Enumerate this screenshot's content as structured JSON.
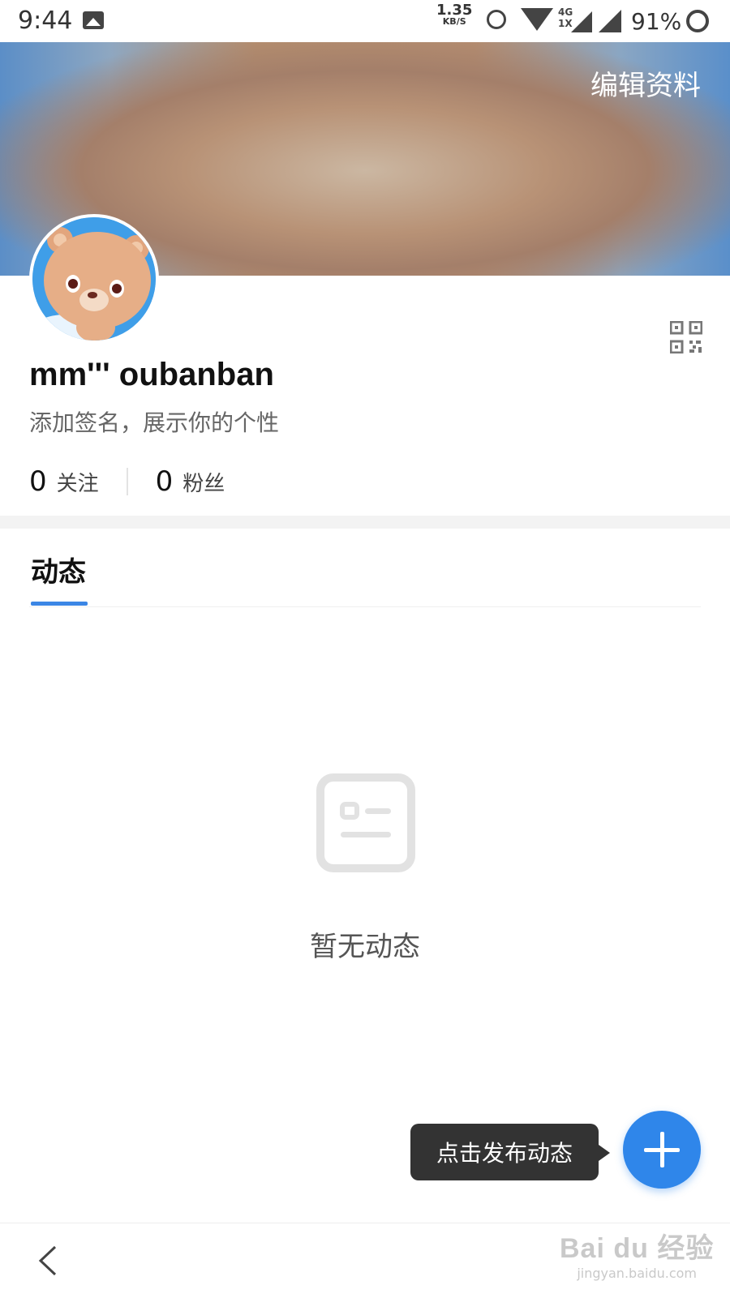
{
  "status_bar": {
    "time": "9:44",
    "speed_value": "1.35",
    "speed_unit": "KB/S",
    "network_top": "4G",
    "network_bottom": "1X",
    "battery": "91%"
  },
  "header": {
    "edit_label": "编辑资料"
  },
  "profile": {
    "username": "mm''' oubanban",
    "signature": "添加签名，展示你的个性",
    "following_count": "0",
    "following_label": "关注",
    "followers_count": "0",
    "followers_label": "粉丝"
  },
  "tabs": [
    {
      "label": "动态",
      "active": true
    }
  ],
  "empty_state": {
    "text": "暂无动态",
    "icon": "document-placeholder-icon"
  },
  "publish": {
    "tooltip": "点击发布动态",
    "icon": "plus-icon"
  },
  "watermark": {
    "logo": "Bai du 经验",
    "sub": "jingyan.baidu.com"
  },
  "colors": {
    "accent": "#2f86ea",
    "tooltip_bg": "#333333",
    "tab_underline": "#3b86e5"
  }
}
